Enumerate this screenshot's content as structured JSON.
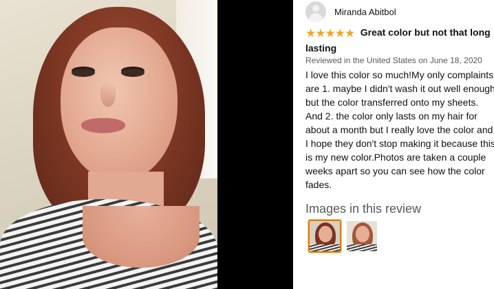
{
  "reviewer": {
    "name": "Miranda Abitbol"
  },
  "rating": {
    "stars": 5,
    "max": 5,
    "color": "#f4a41d"
  },
  "review": {
    "title": "Great color but not that long lasting",
    "date_line": "Reviewed in the United States on June 18, 2020",
    "body": "I love this color so much!My only complaints are 1. maybe I didn't wash it out well enough but the color transferred onto my sheets. And 2. the color only lasts on my hair for about a month but I really love the color and I hope they don't stop making it because this is my new color.Photos are taken a couple weeks apart so you can see how the color fades."
  },
  "images_section": {
    "heading": "Images in this review",
    "thumbnails": [
      {
        "icon": "review-photo-thumbnail",
        "selected": true
      },
      {
        "icon": "review-photo-thumbnail",
        "selected": false
      }
    ],
    "selected_border_color": "#e77600"
  }
}
